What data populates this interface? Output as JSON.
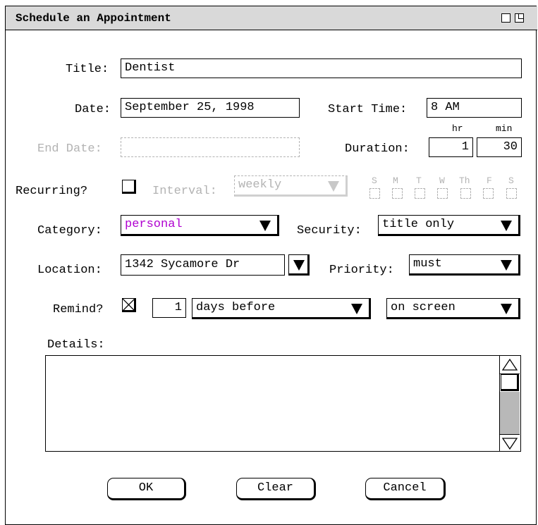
{
  "window": {
    "title": "Schedule an Appointment"
  },
  "form": {
    "title_label": "Title:",
    "title_value": "Dentist",
    "date_label": "Date:",
    "date_value": "September 25, 1998",
    "start_time_label": "Start Time:",
    "start_time_value": "8 AM",
    "end_date_label": "End Date:",
    "end_date_value": "",
    "duration_label": "Duration:",
    "duration_hr_label": "hr",
    "duration_min_label": "min",
    "duration_hr_value": "1",
    "duration_min_value": "30",
    "recurring_label": "Recurring?",
    "recurring_checked": false,
    "interval_label": "Interval:",
    "interval_value": "weekly",
    "days": [
      "S",
      "M",
      "T",
      "W",
      "Th",
      "F",
      "S"
    ],
    "category_label": "Category:",
    "category_value": "personal",
    "category_color": "#b000d0",
    "security_label": "Security:",
    "security_value": "title only",
    "location_label": "Location:",
    "location_value": "1342 Sycamore Dr",
    "priority_label": "Priority:",
    "priority_value": "must",
    "remind_label": "Remind?",
    "remind_checked": true,
    "remind_count": "1",
    "remind_when": "days before",
    "remind_how": "on screen",
    "details_label": "Details:",
    "details_value": ""
  },
  "buttons": {
    "ok": "OK",
    "clear": "Clear",
    "cancel": "Cancel"
  },
  "colors": {
    "disabled": "#b3b3b3",
    "titlebar": "#d9d9d9",
    "scroll_track": "#b8b8b8"
  }
}
